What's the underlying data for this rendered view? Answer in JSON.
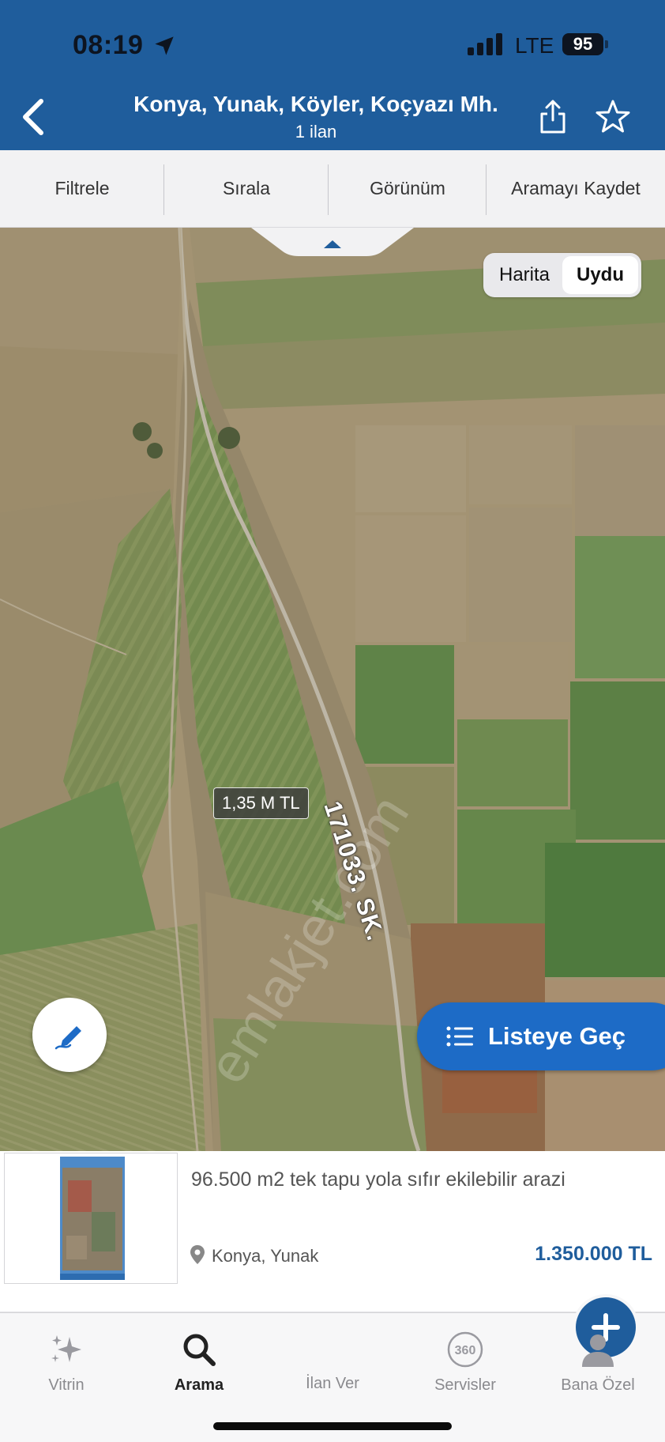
{
  "status_bar": {
    "time": "08:19",
    "network": "LTE",
    "battery": "95"
  },
  "header": {
    "title": "Konya, Yunak, Köyler, Koçyazı Mh.",
    "subtitle": "1 ilan",
    "icons": [
      "chevron-left-icon",
      "share-icon",
      "star-icon"
    ]
  },
  "toolbar": {
    "items": [
      "Filtrele",
      "Sırala",
      "Görünüm",
      "Aramayı Kaydet"
    ]
  },
  "map": {
    "mode_options": [
      "Harita",
      "Uydu"
    ],
    "selected_mode": "Uydu",
    "price_pin": "1,35 M TL",
    "street_label": "171033. SK.",
    "watermark": "emlakjet.com",
    "draw_button_icon": "pencil-draw-icon",
    "list_button": "Listeye Geç"
  },
  "listing": {
    "title": "96.500 m2 tek tapu yola sıfır ekilebilir arazi",
    "location": "Konya, Yunak",
    "price": "1.350.000 TL"
  },
  "tabbar": {
    "items": [
      {
        "label": "Vitrin",
        "icon": "sparkle-icon"
      },
      {
        "label": "Arama",
        "icon": "search-icon"
      },
      {
        "label": "İlan Ver",
        "icon": "plus-icon"
      },
      {
        "label": "Servisler",
        "icon": "360-icon"
      },
      {
        "label": "Bana Özel",
        "icon": "user-icon"
      }
    ],
    "active": "Arama"
  },
  "colors": {
    "brand_blue": "#1f5d9c",
    "button_blue": "#1d6bc6",
    "price_blue": "#1f5d9c"
  }
}
